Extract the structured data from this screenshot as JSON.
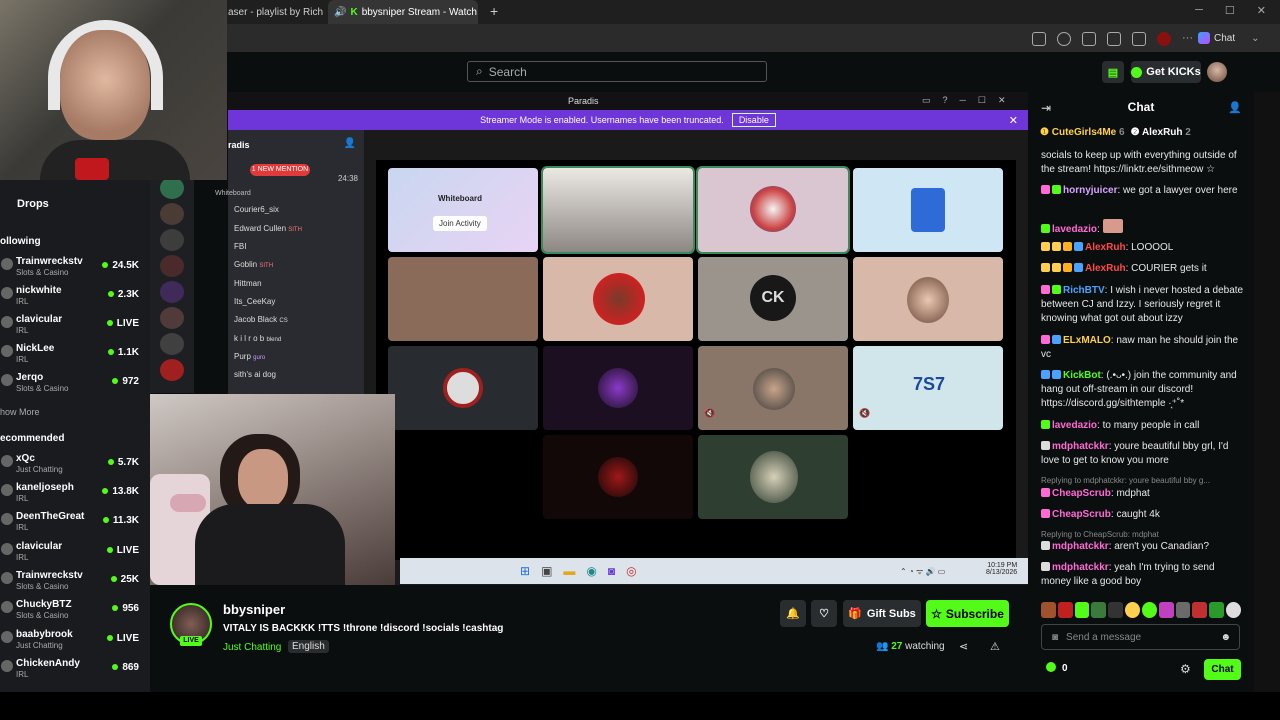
{
  "browser": {
    "tabs": [
      {
        "label": "aser - playlist by Rich"
      },
      {
        "label": "bbysniper Stream - Watch Liv"
      }
    ],
    "new_tab": "+",
    "copilot_label": "Chat",
    "window_min": "─",
    "window_max": "☐",
    "window_close": "✕"
  },
  "header": {
    "search_placeholder": "Search",
    "get_kicks_label": "Get KICKs"
  },
  "sidebar": {
    "drops_label": "Drops",
    "following_label": "ollowing",
    "following": [
      {
        "name": "Trainwreckstv",
        "category": "Slots & Casino",
        "count": "24.5K"
      },
      {
        "name": "nickwhite",
        "category": "IRL",
        "count": "2.3K"
      },
      {
        "name": "clavicular",
        "category": "IRL",
        "count": "LIVE"
      },
      {
        "name": "NickLee",
        "category": "IRL",
        "count": "1.1K"
      },
      {
        "name": "Jerqo",
        "category": "Slots & Casino",
        "count": "972"
      }
    ],
    "show_more_label": "how More",
    "recommended_label": "ecommended",
    "recommended": [
      {
        "name": "xQc",
        "category": "Just Chatting",
        "count": "5.7K"
      },
      {
        "name": "kaneljoseph",
        "category": "IRL",
        "count": "13.8K"
      },
      {
        "name": "DeenTheGreat",
        "category": "IRL",
        "count": "11.3K"
      },
      {
        "name": "clavicular",
        "category": "IRL",
        "count": "LIVE"
      },
      {
        "name": "Trainwreckstv",
        "category": "Slots & Casino",
        "count": "25K"
      },
      {
        "name": "ChuckyBTZ",
        "category": "Slots & Casino",
        "count": "956"
      },
      {
        "name": "baabybrook",
        "category": "Just Chatting",
        "count": "LIVE"
      },
      {
        "name": "ChickenAndy",
        "category": "IRL",
        "count": "869"
      }
    ]
  },
  "stream": {
    "app_title": "Paradis",
    "banner_text": "Streamer Mode is enabled. Usernames have been truncated.",
    "banner_button": "Disable",
    "server_name": "radis",
    "mention_badge": "1 NEW MENTION",
    "voice_time": "24:38",
    "whiteboard_label": "Whiteboard",
    "join_activity": "Join Activity",
    "members": [
      "Courier6_six",
      "Edward Cullen",
      "FBI",
      "Goblin",
      "Hittman",
      "Its_CeeKay",
      "Jacob Black",
      "k i l r o b",
      "Purp",
      "sith's ai dog"
    ],
    "member_tags": {
      "Edward Cullen": "SITH",
      "Goblin": "SITH",
      "Jacob Black": "CS",
      "Purp": "guro",
      "k i l r o b": "blend"
    },
    "clock_time": "10:19 PM",
    "clock_date": "8/13/2026",
    "tile_text": "CK"
  },
  "channel": {
    "name": "bbysniper",
    "live_label": "LIVE",
    "title": "VITALY IS BACKKK !TTS !throne !discord !socials !cashtag",
    "category": "Just Chatting",
    "language": "English",
    "gift_subs_label": "Gift Subs",
    "subscribe_label": "Subscribe",
    "viewers": "27",
    "watching_label": "watching"
  },
  "chat": {
    "title": "Chat",
    "pinned": [
      {
        "name": "CuteGirls4Me",
        "count": "6"
      },
      {
        "name": "AlexRuh",
        "count": "2"
      }
    ],
    "messages": [
      {
        "user": "",
        "color": "#e8e8e8",
        "text": "socials to keep up with everything outside of the stream! https://linktr.ee/sithmeow ☆"
      },
      {
        "user": "hornyjuicer",
        "color": "#d5a3ff",
        "text": ": we got a lawyer over here"
      },
      {
        "user": "lavedazio",
        "color": "#ff6ad5",
        "text": ":"
      },
      {
        "user": "AlexRuh",
        "color": "#ff4a4a",
        "text": ": LOOOOL"
      },
      {
        "user": "AlexRuh",
        "color": "#ff4a4a",
        "text": ": COURIER gets it"
      },
      {
        "user": "RichBTV",
        "color": "#4aa3ff",
        "text": ": I wish i never hosted a debate between CJ and Izzy. I seriously regret it knowing what got out about izzy"
      },
      {
        "user": "ELxMALO",
        "color": "#ffd04d",
        "text": ": naw man he should join the vc"
      },
      {
        "user": "KickBot",
        "color": "#53fc18",
        "text": ": (.•ᴗ•.) join the community and hang out off-stream in our discord! https://discord.gg/sithtemple ·͙⁺˚*"
      },
      {
        "user": "lavedazio",
        "color": "#ff6ad5",
        "text": ": to many people in call"
      },
      {
        "user": "mdphatckkr",
        "color": "#ff6ad5",
        "text": ": youre beautiful bby grl, I'd love to get to know you more"
      },
      {
        "user": "CheapScrub",
        "color": "#ff6ad5",
        "text": ": mdphat",
        "reply": "Replying to mdphatckkr: youre beautiful bby g..."
      },
      {
        "user": "CheapScrub",
        "color": "#ff6ad5",
        "text": ": caught 4k"
      },
      {
        "user": "mdphatckkr",
        "color": "#ff6ad5",
        "text": ": aren't you Canadian?",
        "reply": "Replying to CheapScrub: mdphat"
      },
      {
        "user": "mdphatckkr",
        "color": "#ff6ad5",
        "text": ": yeah I'm trying to send money like a good boy"
      }
    ],
    "input_placeholder": "Send a message",
    "points": "0",
    "send_label": "Chat"
  },
  "colors": {
    "accent": "#53fc18",
    "banner": "#6e35d8",
    "bg": "#0b0e0f"
  }
}
